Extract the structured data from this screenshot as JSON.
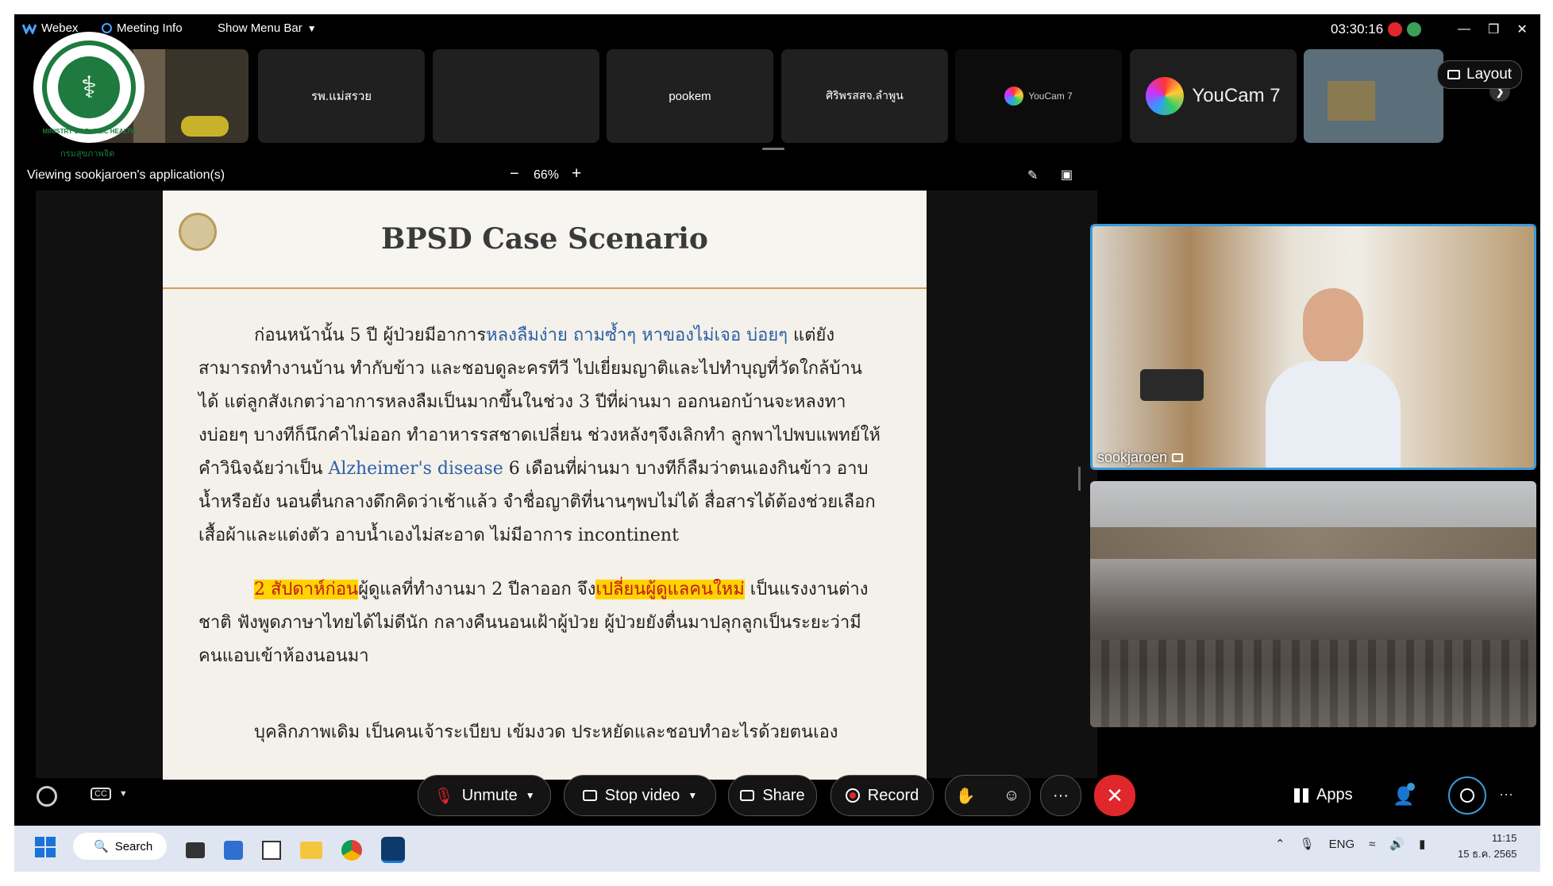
{
  "app": {
    "name": "Webex",
    "meeting_info": "Meeting Info",
    "show_menu_bar": "Show Menu Bar",
    "timer": "03:30:16"
  },
  "thumbnails": [
    {
      "label": ""
    },
    {
      "label": "รพ.แม่สรวย"
    },
    {
      "label": ""
    },
    {
      "label": "pookem"
    },
    {
      "label": "ศิริพรสสจ.ลำพูน"
    },
    {
      "label": "YouCam 7"
    },
    {
      "label": "YouCam 7"
    },
    {
      "label": ""
    }
  ],
  "layout_button": "Layout",
  "viewing": {
    "text": "Viewing sookjaroen's application(s)",
    "zoom": "66%"
  },
  "slide": {
    "title": "BPSD Case Scenario",
    "p1": {
      "a": "ก่อนหน้านั้น 5 ปี ผู้ป่วยมีอาการ",
      "b": "หลงลืมง่าย   ถามซ้ำๆ  หาของไม่เจอ บ่อยๆ",
      "c": "  แต่ยังสามารถทำงานบ้าน ทำกับข้าว และชอบดูละครทีวี ไปเยี่ยมญาติและไปทำบุญที่วัดใกล้บ้านได้ แต่ลูกสังเกตว่าอาการหลงลืมเป็นมากขึ้นในช่วง 3 ปีที่ผ่านมา ออกนอกบ้านจะหลงทางบ่อยๆ บางทีก็นึกคำไม่ออก ทำอาหารรสชาดเปลี่ยน ช่วงหลังๆจึงเลิกทำ ลูกพาไปพบแพทย์ให้คำวินิจฉัยว่าเป็น ",
      "d": "Alzheimer's disease",
      "e": "  6 เดือนที่ผ่านมา บางทีก็ลืมว่าตนเองกินข้าว อาบน้ำหรือยัง นอนตื่นกลางดึกคิดว่าเช้าแล้ว จำชื่อญาติที่นานๆพบไม่ได้ สื่อสารได้ต้องช่วยเลือกเสื้อผ้าและแต่งตัว อาบน้ำเองไม่สะอาด ไม่มีอาการ incontinent"
    },
    "p2": {
      "a": "2  สัปดาห์ก่อน",
      "b": "ผู้ดูแลที่ทำงานมา 2 ปีลาออก จึง",
      "c": "เปลี่ยนผู้ดูแลคนใหม่",
      "d": " เป็นแรงงานต่างชาติ ฟังพูดภาษาไทยได้ไม่ดีนัก กลางคืนนอนเฝ้าผู้ป่วย ผู้ป่วยยังตื่นมาปลุกลูกเป็นระยะว่ามีคนแอบเข้าห้องนอนมา"
    },
    "p3": "บุคลิกภาพเดิม เป็นคนเจ้าระเบียบ เข้มงวด ประหยัดและชอบทำอะไรด้วยตนเอง"
  },
  "logo": {
    "text": "MINISTRY OF PUBLIC HEALTH",
    "sub": "กรมสุขภาพจิต"
  },
  "videos": {
    "speaker": "sookjaroen"
  },
  "controls": {
    "unmute": "Unmute",
    "stop_video": "Stop video",
    "share": "Share",
    "record": "Record",
    "apps": "Apps",
    "more": "···"
  },
  "taskbar": {
    "search": "Search",
    "lang": "ENG",
    "time": "11:15",
    "date": "15 ธ.ค. 2565"
  },
  "colors": {
    "accent": "#3a9ad9",
    "end_call": "#e0272b",
    "highlight": "#ffd400"
  }
}
